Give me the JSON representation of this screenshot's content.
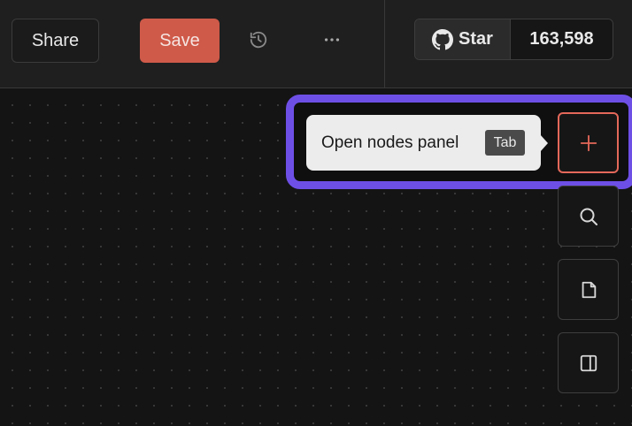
{
  "toolbar": {
    "share_label": "Share",
    "save_label": "Save",
    "history_icon": "history-icon",
    "more_icon": "more-horizontal-icon"
  },
  "github": {
    "star_label": "Star",
    "star_count": "163,598",
    "icon": "github-icon"
  },
  "tooltip": {
    "text": "Open nodes panel",
    "shortcut": "Tab"
  },
  "side_panel": {
    "buttons": [
      {
        "name": "add-node",
        "icon": "plus-icon"
      },
      {
        "name": "search",
        "icon": "search-icon"
      },
      {
        "name": "sticky-note",
        "icon": "sticky-note-icon"
      },
      {
        "name": "toggle-panel",
        "icon": "panel-icon"
      }
    ]
  },
  "colors": {
    "save": "#cf5a49",
    "highlight": "#6e4fe6",
    "add_accent": "#e4685a",
    "background": "#141414"
  }
}
